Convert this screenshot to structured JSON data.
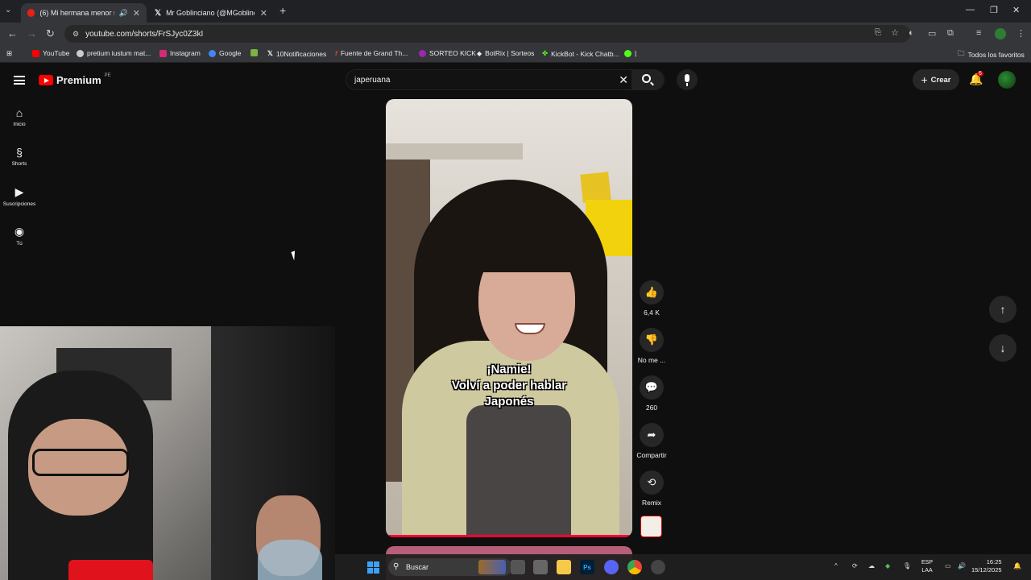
{
  "browser": {
    "tabs": [
      {
        "title": "(6) Mi hermana menor se c",
        "active": true
      },
      {
        "title": "Mr Goblinciano (@MGoblincian",
        "active": false
      }
    ],
    "new_tab": "+",
    "url": "youtube.com/shorts/FrSJyc0Z3kI",
    "window_controls": {
      "minimize": "—",
      "restore": "❐",
      "close": "✕"
    }
  },
  "bookmarks": {
    "items": [
      {
        "label": "YouTube",
        "color": "#ff0000"
      },
      {
        "label": "pretium iustum mat...",
        "color": "#cccccc"
      },
      {
        "label": "Instagram",
        "color": "#d62976"
      },
      {
        "label": "Google",
        "color": "#4285f4"
      },
      {
        "label": "",
        "color": "#7cb342"
      },
      {
        "label": "10Notificaciones",
        "color": "#ffffff"
      },
      {
        "label": "Fuente de Grand Th...",
        "color": "#e53935"
      },
      {
        "label": "SORTEO KICK",
        "color": "#9c27b0"
      },
      {
        "label": "BotRix | Sorteos",
        "color": "#ffffff"
      },
      {
        "label": "KickBot - Kick Chatb...",
        "color": "#53fc18"
      },
      {
        "label": "|",
        "color": "#53fc18"
      }
    ],
    "all_favorites": "Todos los favoritos"
  },
  "youtube": {
    "logo_text": "Premium",
    "region": "PE",
    "search_value": "japeruana",
    "create_label": "Crear",
    "notifications_count": "6",
    "sidebar": [
      {
        "label": "Inicio",
        "icon": "⌂"
      },
      {
        "label": "Shorts",
        "icon": "§"
      },
      {
        "label": "Suscripciones",
        "icon": "▶"
      },
      {
        "label": "Tú",
        "icon": "◉"
      }
    ]
  },
  "short": {
    "caption_lines": [
      "¡Namie!",
      "Volví a poder hablar",
      "Japonés"
    ],
    "likes": "6,4 K",
    "dislike_label": "No me ...",
    "comments": "260",
    "share_label": "Compartir",
    "remix_label": "Remix"
  },
  "taskbar": {
    "search_label": "Buscar",
    "lang_top": "ESP",
    "lang_bottom": "LAA",
    "time": "16:25",
    "date": "15/12/2025",
    "apps": [
      "Ps"
    ]
  }
}
